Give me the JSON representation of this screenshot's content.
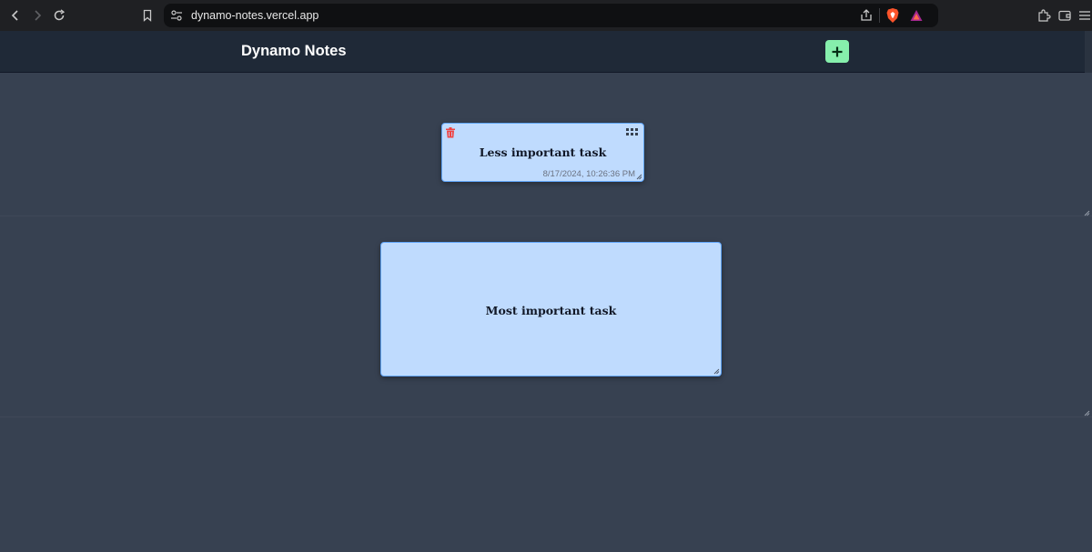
{
  "browser": {
    "url": "dynamo-notes.vercel.app"
  },
  "app": {
    "title": "Dynamo Notes"
  },
  "notes": [
    {
      "text": "Less important task",
      "timestamp": "8/17/2024, 10:26:36 PM"
    },
    {
      "text": "Most important task"
    }
  ],
  "colors": {
    "accent_add": "#86efac",
    "note_bg": "#bfdbfe",
    "note_border": "#60a5fa",
    "delete": "#ef4444",
    "canvas_bg": "#374151",
    "header_bg": "#1f2937"
  }
}
